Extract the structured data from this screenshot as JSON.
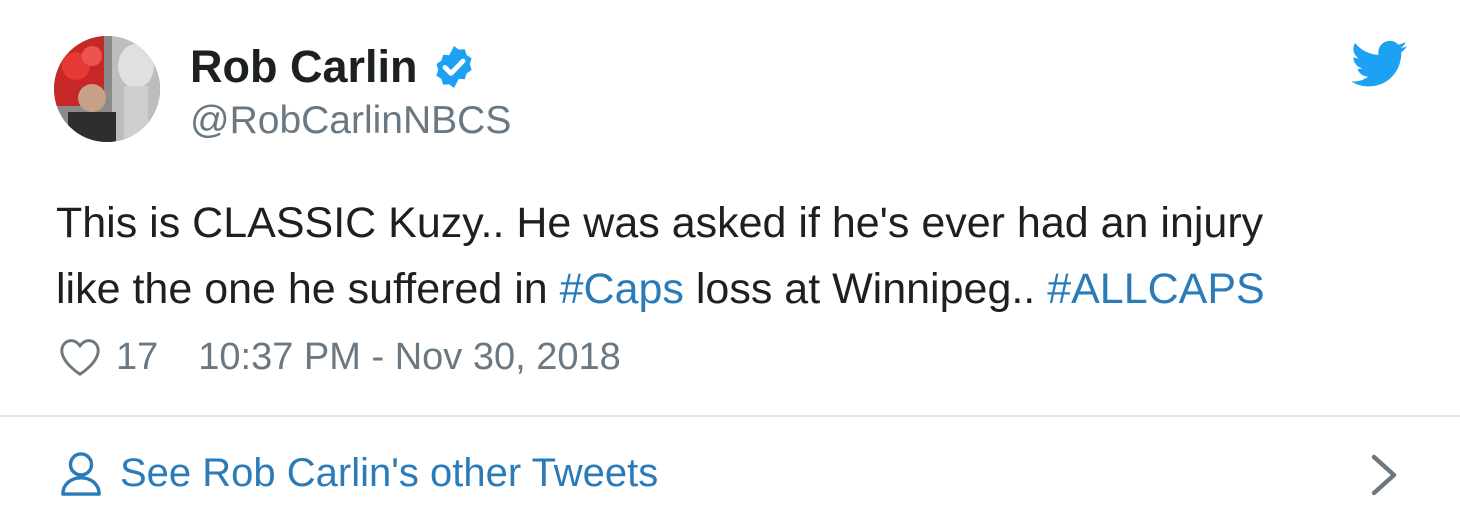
{
  "author": {
    "display_name": "Rob Carlin",
    "handle": "@RobCarlinNBCS",
    "verified": true
  },
  "tweet": {
    "line1": "This is CLASSIC Kuzy.. He was asked if he's ever had an injury",
    "line2_part1": "like the one he suffered in ",
    "hashtag1": "#Caps",
    "line2_part2": " loss at Winnipeg.. ",
    "hashtag2": "#ALLCAPS"
  },
  "meta": {
    "like_count": "17",
    "timestamp": "10:37 PM - Nov 30, 2018"
  },
  "footer": {
    "see_more_label": "See Rob Carlin's other Tweets"
  },
  "icons": {
    "verified": "verified-badge-icon",
    "brand": "twitter-bird-icon",
    "like": "heart-icon",
    "profile": "person-icon",
    "more": "chevron-right-icon"
  },
  "colors": {
    "twitter_blue": "#1da1f2",
    "link": "#2b7bb9",
    "text": "#1c2022",
    "secondary": "#697882",
    "divider": "#e1e8ed"
  }
}
